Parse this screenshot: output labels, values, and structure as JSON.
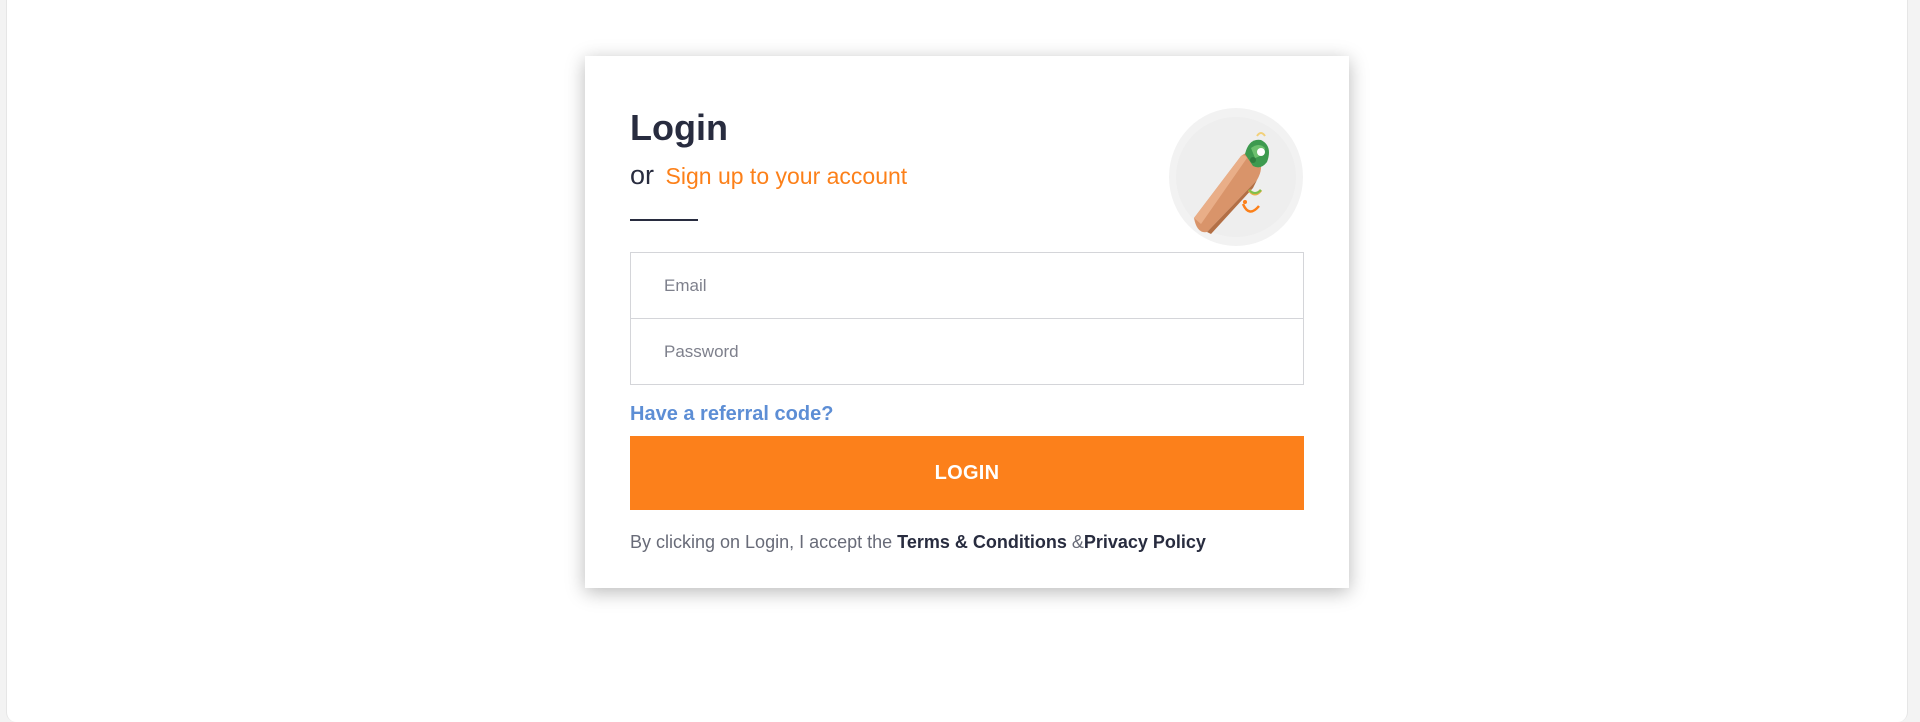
{
  "login": {
    "title": "Login",
    "or_text": "or",
    "signup_link": "Sign up to your account",
    "avatar_icon": "wrap-food-icon"
  },
  "form": {
    "email_placeholder": "Email",
    "email_value": "",
    "password_placeholder": "Password",
    "password_value": "",
    "referral_link": "Have a referral code?",
    "login_button": "LOGIN"
  },
  "terms": {
    "prefix": "By clicking on Login, I accept the ",
    "terms_link": "Terms & Conditions",
    "separator": " &",
    "privacy_link": "Privacy Policy"
  },
  "colors": {
    "accent": "#fc8019",
    "link_blue": "#5d8ed5",
    "text_dark": "#282c3f"
  }
}
